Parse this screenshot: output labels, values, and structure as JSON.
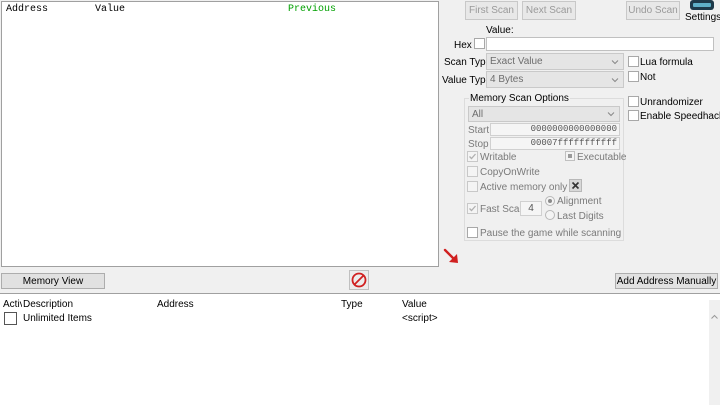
{
  "found_list": {
    "columns": [
      "Address",
      "Value",
      "Previous"
    ],
    "previous_color": "#00a000"
  },
  "scan": {
    "first_scan": "First Scan",
    "next_scan": "Next Scan",
    "undo_scan": "Undo Scan",
    "settings": "Settings",
    "value_label": "Value:",
    "hex_label": "Hex",
    "scan_type_label": "Scan Type",
    "scan_type_value": "Exact Value",
    "value_type_label": "Value Type",
    "value_type_value": "4 Bytes",
    "lua_formula": "Lua formula",
    "not_label": "Not"
  },
  "memory_options": {
    "title": "Memory Scan Options",
    "region": "All",
    "start_label": "Start",
    "start_value": "0000000000000000",
    "stop_label": "Stop",
    "stop_value": "00007fffffffffff",
    "writable": "Writable",
    "executable": "Executable",
    "copy_on_write": "CopyOnWrite",
    "active_memory_only": "Active memory only",
    "fast_scan": "Fast Scan",
    "fast_scan_value": "4",
    "alignment": "Alignment",
    "last_digits": "Last Digits",
    "pause_game": "Pause the game while scanning"
  },
  "extra": {
    "unrandomizer": "Unrandomizer",
    "enable_speedhack": "Enable Speedhack"
  },
  "bottom_bar": {
    "memory_view": "Memory View",
    "add_address_manually": "Add Address Manually"
  },
  "address_list": {
    "columns": [
      "Active",
      "Description",
      "Address",
      "Type",
      "Value"
    ],
    "rows": [
      {
        "description": "Unlimited Items",
        "address": "",
        "type": "",
        "value": "<script>"
      }
    ]
  }
}
